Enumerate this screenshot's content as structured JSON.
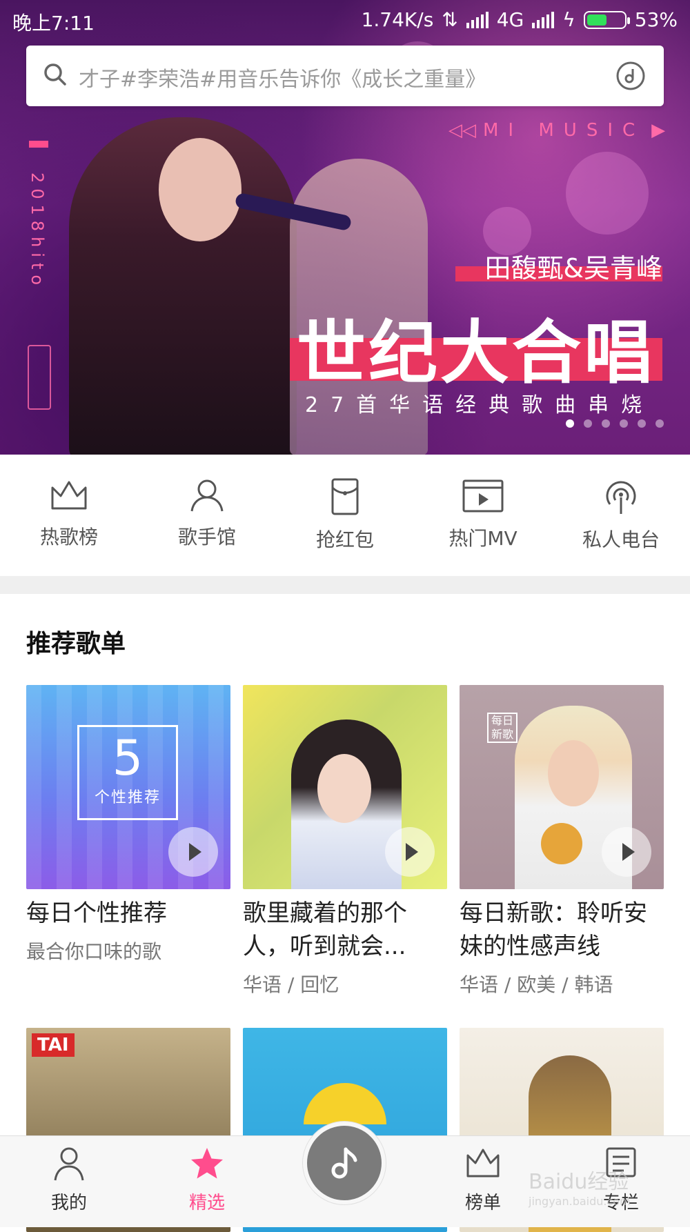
{
  "status_bar": {
    "time": "晚上7:11",
    "net_speed": "1.74K/s",
    "network": "4G",
    "battery_text": "53%",
    "battery_level": 0.53
  },
  "search": {
    "placeholder": "才子#李荣浩#用音乐告诉你《成长之重量》"
  },
  "banner": {
    "brand": "MI MUSIC",
    "side_text": "2018hito",
    "artists": "田馥甄&吴青峰",
    "title": "世纪大合唱",
    "subtitle": "27首华语经典歌曲串烧",
    "dots_total": 6,
    "dots_active": 1
  },
  "categories": [
    {
      "label": "热歌榜",
      "icon": "crown-icon"
    },
    {
      "label": "歌手馆",
      "icon": "person-icon"
    },
    {
      "label": "抢红包",
      "icon": "red-packet-icon"
    },
    {
      "label": "热门MV",
      "icon": "video-icon"
    },
    {
      "label": "私人电台",
      "icon": "radio-icon"
    }
  ],
  "recommended": {
    "title": "推荐歌单",
    "playlists": [
      {
        "title": "每日个性推荐",
        "subtitle": "最合你口味的歌",
        "badge_number": "5",
        "badge_label": "个性推荐"
      },
      {
        "title": "歌里藏着的那个人，听到就会...",
        "subtitle": "华语 / 回忆"
      },
      {
        "title": "每日新歌：聆听安妹的性感声线",
        "subtitle": "华语 / 欧美 / 韩语",
        "stamp": "每日新歌"
      }
    ],
    "row2_tag": "TAI"
  },
  "bottom_nav": [
    {
      "label": "我的",
      "icon": "person-icon"
    },
    {
      "label": "精选",
      "icon": "star-icon",
      "active": true
    },
    {
      "label": "",
      "icon": "music-note-icon"
    },
    {
      "label": "榜单",
      "icon": "crown-icon"
    },
    {
      "label": "专栏",
      "icon": "column-icon"
    }
  ],
  "watermark": {
    "text": "Baidu经验",
    "url": "jingyan.baidu.com"
  },
  "colors": {
    "accent": "#ff4d8d",
    "banner_bar": "#e8365f"
  }
}
